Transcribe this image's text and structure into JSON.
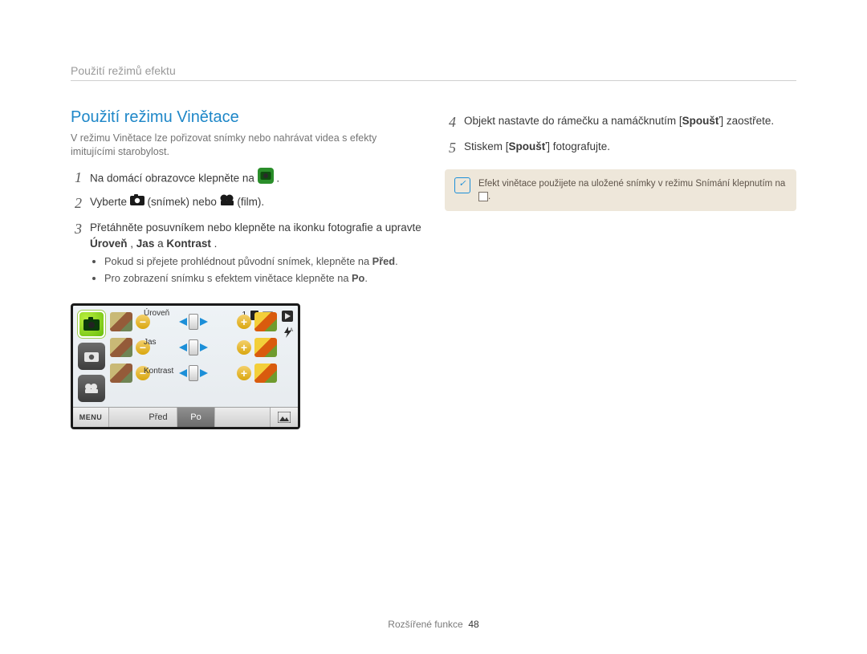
{
  "running_head": "Použití režimů efektu",
  "section_title": "Použití režimu Vinětace",
  "intro": "V režimu Vinětace lze pořizovat snímky nebo nahrávat videa s efekty imitujícími starobylost.",
  "left_steps": {
    "s1_a": "Na domácí obrazovce klepněte na ",
    "s1_b": ".",
    "s2_a": "Vyberte ",
    "s2_b": " (snímek) nebo ",
    "s2_c": " (film).",
    "s3_a": "Přetáhněte posuvníkem nebo klepněte na ikonku fotografie a upravte ",
    "s3_b1": "Úroveň",
    "s3_comma1": ", ",
    "s3_b2": "Jas",
    "s3_mid": " a ",
    "s3_b3": "Kontrast",
    "s3_end": ".",
    "s3_sub1_a": "Pokud si přejete prohlédnout původní snímek, klepněte na ",
    "s3_sub1_b": "Před",
    "s3_sub1_c": ".",
    "s3_sub2_a": "Pro zobrazení snímku s efektem vinětace klepněte na ",
    "s3_sub2_b": "Po",
    "s3_sub2_c": "."
  },
  "right_steps": {
    "s4_a": "Objekt nastavte do rámečku a namáčknutím [",
    "s4_b": "Spoušť",
    "s4_c": "] zaostřete.",
    "s5_a": "Stiskem [",
    "s5_b": "Spoušť",
    "s5_c": "] fotografujte."
  },
  "tip_text_a": "Efekt vinětace použijete na uložené snímky v režimu Snímání klepnutím na ",
  "tip_text_b": ".",
  "screen": {
    "status_count": "1",
    "labels": {
      "level": "Úroveň",
      "brightness": "Jas",
      "contrast": "Kontrast"
    },
    "menu": "MENU",
    "before": "Před",
    "after": "Po"
  },
  "footer_section": "Rozšířené funkce",
  "footer_page": "48"
}
